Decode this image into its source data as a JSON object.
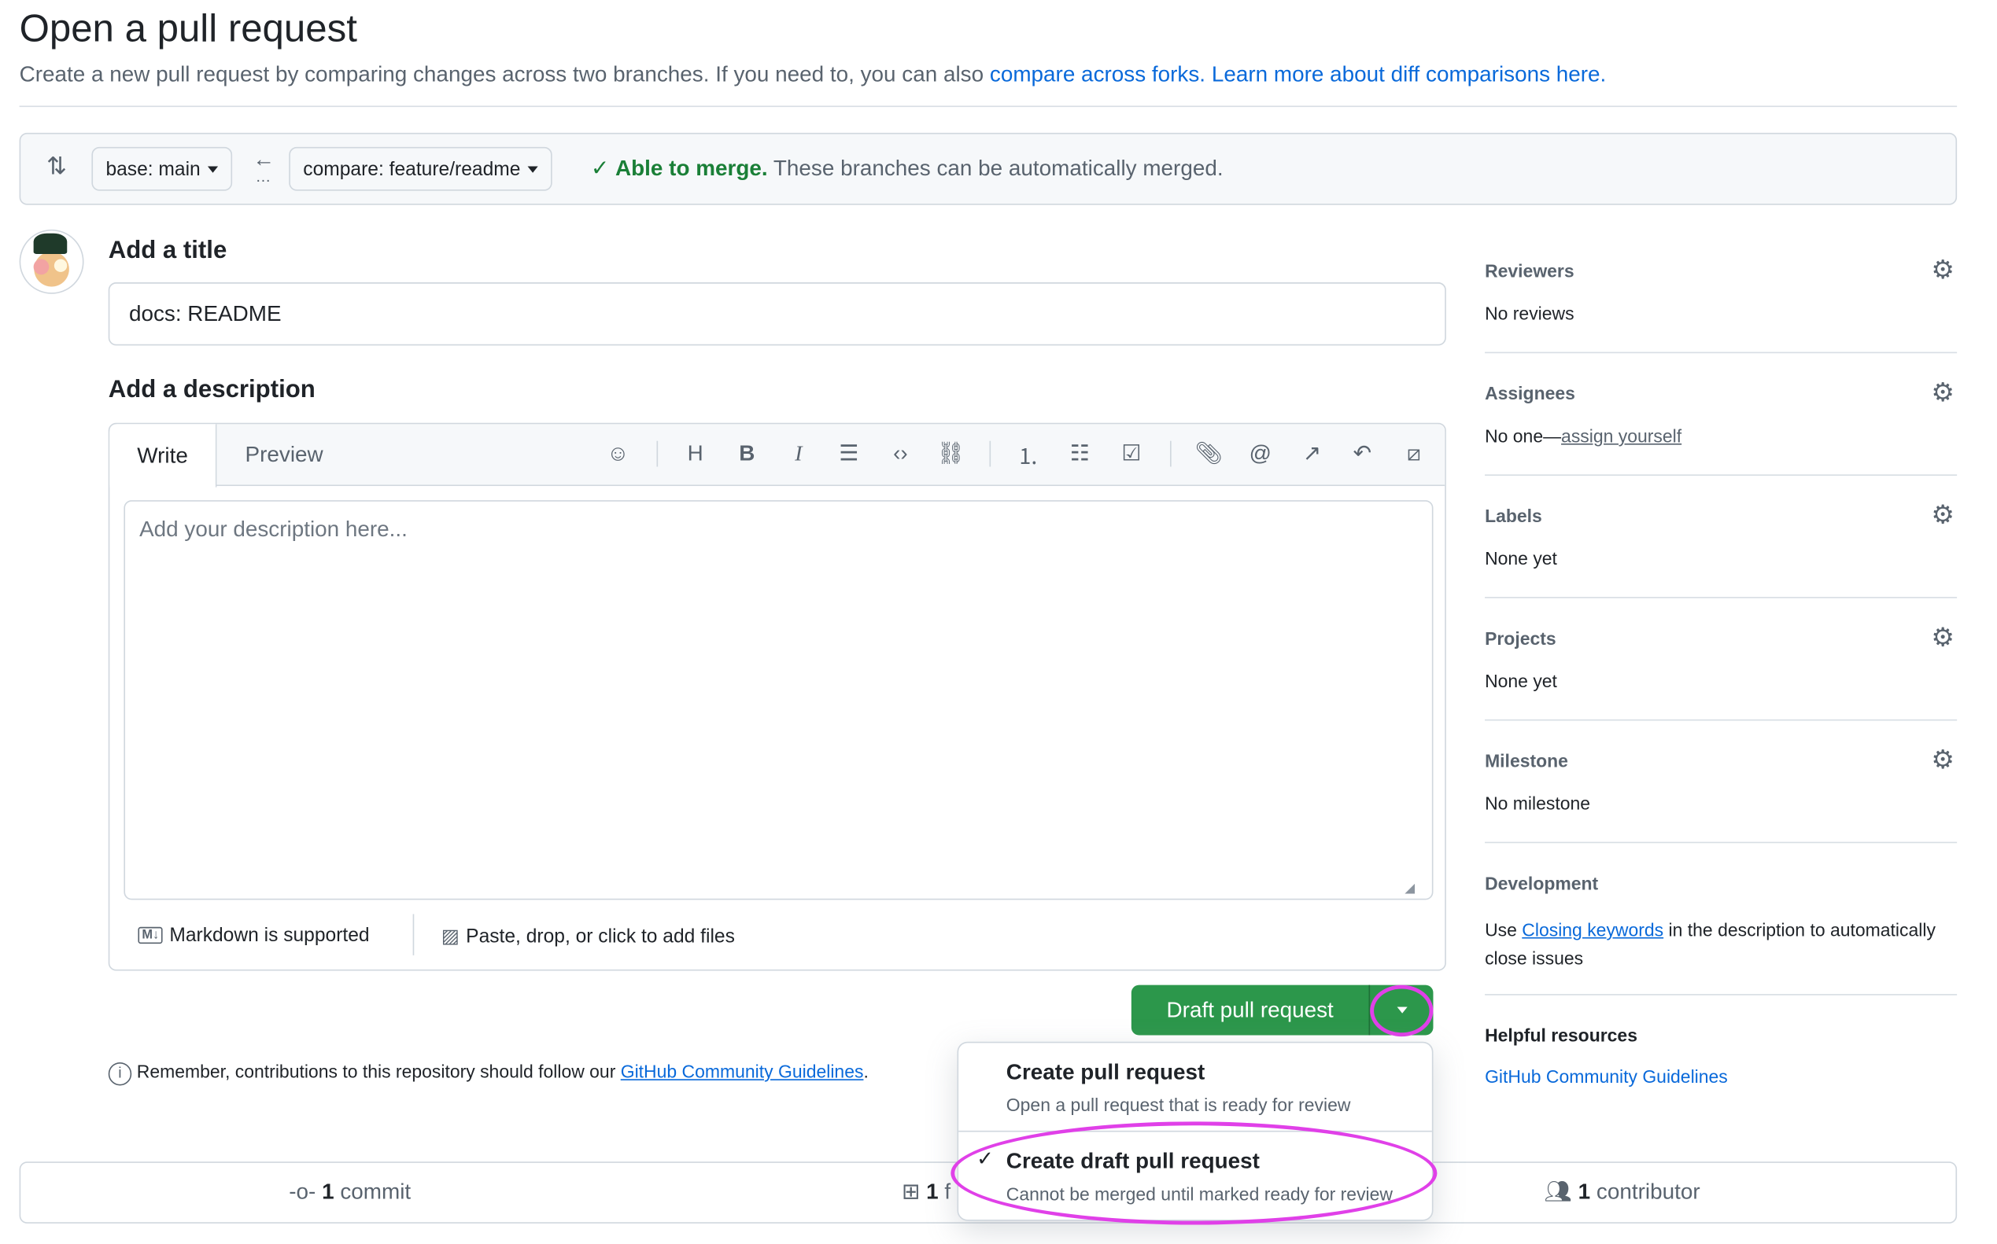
{
  "page": {
    "title": "Open a pull request",
    "subtitle": "Create a new pull request by comparing changes across two branches. If you need to, you can also",
    "link_forks": "compare across forks.",
    "link_learn": "Learn more about diff comparisons here."
  },
  "range": {
    "base": "base: main",
    "compare": "compare: feature/readme",
    "merge_status": "Able to merge.",
    "merge_detail": "These branches can be automatically merged.",
    "ellipsis": "…"
  },
  "form": {
    "title_label": "Add a title",
    "title_value": "docs: README",
    "desc_label": "Add a description",
    "tab_write": "Write",
    "tab_preview": "Preview",
    "desc_placeholder": "Add your description here...",
    "markdown": "Markdown is supported",
    "attach": "Paste, drop, or click to add files",
    "toolbar": [
      "copilot",
      "heading",
      "bold",
      "italic",
      "quote",
      "code",
      "link",
      "ordered-list",
      "unordered-list",
      "task-list",
      "attach",
      "mention",
      "cross-reference",
      "undo",
      "slash-command"
    ]
  },
  "actions": {
    "draft_button": "Draft pull request",
    "menu": [
      {
        "title": "Create pull request",
        "desc": "Open a pull request that is ready for review",
        "selected": false
      },
      {
        "title": "Create draft pull request",
        "desc": "Cannot be merged until marked ready for review",
        "selected": true
      }
    ],
    "remember": "Remember, contributions to this repository should follow our",
    "guidelines_link": "GitHub Community Guidelines"
  },
  "stats": {
    "commits_count": "1",
    "commits_label": "commit",
    "files_count": "1",
    "files_label": "f",
    "contrib_count": "1",
    "contrib_label": "contributor"
  },
  "sidebar": {
    "reviewers": {
      "label": "Reviewers",
      "value": "No reviews"
    },
    "assignees": {
      "label": "Assignees",
      "value": "No one—",
      "link": "assign yourself"
    },
    "labels": {
      "label": "Labels",
      "value": "None yet"
    },
    "projects": {
      "label": "Projects",
      "value": "None yet"
    },
    "milestone": {
      "label": "Milestone",
      "value": "No milestone"
    },
    "development": {
      "label": "Development",
      "pre": "Use",
      "link": "Closing keywords",
      "post": "in the description to automatically close issues"
    },
    "helpful": {
      "label": "Helpful resources",
      "link": "GitHub Community Guidelines"
    }
  },
  "colors": {
    "accent": "#0969da",
    "success": "#1a7f37",
    "button": "#2c974b",
    "annotation": "#e040e8"
  }
}
